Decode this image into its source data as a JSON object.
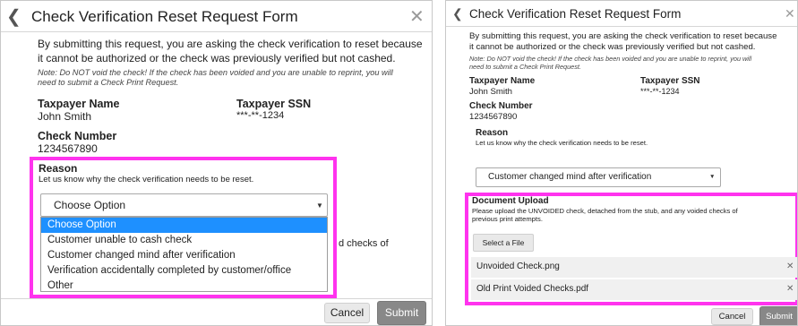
{
  "left": {
    "title": "Check Verification Reset Request Form",
    "back_glyph": "❮",
    "close_glyph": "✕",
    "intro_line1": "By submitting this request, you are asking the check verification to reset because",
    "intro_line2": "it cannot be authorized or the check was previously verified but not cashed.",
    "note_line1": "Note: Do NOT void the check! If the check has been voided and you are unable to reprint, you will",
    "note_line2": "need to submit a Check Print Request.",
    "taxpayer_name_label": "Taxpayer Name",
    "taxpayer_name": "John Smith",
    "taxpayer_ssn_label": "Taxpayer SSN",
    "taxpayer_ssn": "***-**-1234",
    "check_number_label": "Check Number",
    "check_number": "1234567890",
    "reason_label": "Reason",
    "reason_help": "Let us know why the check verification needs to be reset.",
    "reason_selected": "Choose Option",
    "caret_glyph": "▼",
    "dropdown_options": [
      "Choose Option",
      "Customer unable to cash check",
      "Customer changed mind after verification",
      "Verification accidentally completed by customer/office",
      "Other"
    ],
    "peek_text": "d checks of",
    "cancel_label": "Cancel",
    "submit_label": "Submit"
  },
  "right": {
    "title": "Check Verification Reset Request Form",
    "back_glyph": "❮",
    "close_glyph": "✕",
    "intro_line1": "By submitting this request, you are asking the check verification to reset because",
    "intro_line2": "it cannot be authorized or the check was previously verified but not cashed.",
    "note_line1": "Note: Do NOT void the check! If the check has been voided and you are unable to reprint, you will",
    "note_line2": "need to submit a Check Print Request.",
    "taxpayer_name_label": "Taxpayer Name",
    "taxpayer_name": "John Smith",
    "taxpayer_ssn_label": "Taxpayer SSN",
    "taxpayer_ssn": "***-**-1234",
    "check_number_label": "Check Number",
    "check_number": "1234567890",
    "reason_label": "Reason",
    "reason_help": "Let us know why the check verification needs to be reset.",
    "reason_selected": "Customer changed mind after verification",
    "caret_glyph": "▼",
    "upload_label": "Document Upload",
    "upload_help_line1": "Please upload the UNVOIDED check, detached from the stub, and any voided checks of",
    "upload_help_line2": "previous print attempts.",
    "select_file_label": "Select a File",
    "files": [
      "Unvoided Check.png",
      "Old Print Voided Checks.pdf"
    ],
    "remove_glyph": "✕",
    "cancel_label": "Cancel",
    "submit_label": "Submit"
  }
}
